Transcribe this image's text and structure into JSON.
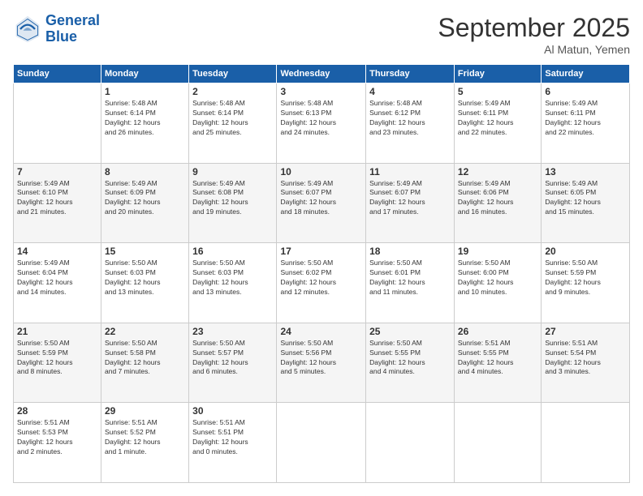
{
  "header": {
    "logo_line1": "General",
    "logo_line2": "Blue",
    "month": "September 2025",
    "location": "Al Matun, Yemen"
  },
  "days_of_week": [
    "Sunday",
    "Monday",
    "Tuesday",
    "Wednesday",
    "Thursday",
    "Friday",
    "Saturday"
  ],
  "weeks": [
    [
      {
        "day": "",
        "info": ""
      },
      {
        "day": "1",
        "info": "Sunrise: 5:48 AM\nSunset: 6:14 PM\nDaylight: 12 hours\nand 26 minutes."
      },
      {
        "day": "2",
        "info": "Sunrise: 5:48 AM\nSunset: 6:14 PM\nDaylight: 12 hours\nand 25 minutes."
      },
      {
        "day": "3",
        "info": "Sunrise: 5:48 AM\nSunset: 6:13 PM\nDaylight: 12 hours\nand 24 minutes."
      },
      {
        "day": "4",
        "info": "Sunrise: 5:48 AM\nSunset: 6:12 PM\nDaylight: 12 hours\nand 23 minutes."
      },
      {
        "day": "5",
        "info": "Sunrise: 5:49 AM\nSunset: 6:11 PM\nDaylight: 12 hours\nand 22 minutes."
      },
      {
        "day": "6",
        "info": "Sunrise: 5:49 AM\nSunset: 6:11 PM\nDaylight: 12 hours\nand 22 minutes."
      }
    ],
    [
      {
        "day": "7",
        "info": "Sunrise: 5:49 AM\nSunset: 6:10 PM\nDaylight: 12 hours\nand 21 minutes."
      },
      {
        "day": "8",
        "info": "Sunrise: 5:49 AM\nSunset: 6:09 PM\nDaylight: 12 hours\nand 20 minutes."
      },
      {
        "day": "9",
        "info": "Sunrise: 5:49 AM\nSunset: 6:08 PM\nDaylight: 12 hours\nand 19 minutes."
      },
      {
        "day": "10",
        "info": "Sunrise: 5:49 AM\nSunset: 6:07 PM\nDaylight: 12 hours\nand 18 minutes."
      },
      {
        "day": "11",
        "info": "Sunrise: 5:49 AM\nSunset: 6:07 PM\nDaylight: 12 hours\nand 17 minutes."
      },
      {
        "day": "12",
        "info": "Sunrise: 5:49 AM\nSunset: 6:06 PM\nDaylight: 12 hours\nand 16 minutes."
      },
      {
        "day": "13",
        "info": "Sunrise: 5:49 AM\nSunset: 6:05 PM\nDaylight: 12 hours\nand 15 minutes."
      }
    ],
    [
      {
        "day": "14",
        "info": "Sunrise: 5:49 AM\nSunset: 6:04 PM\nDaylight: 12 hours\nand 14 minutes."
      },
      {
        "day": "15",
        "info": "Sunrise: 5:50 AM\nSunset: 6:03 PM\nDaylight: 12 hours\nand 13 minutes."
      },
      {
        "day": "16",
        "info": "Sunrise: 5:50 AM\nSunset: 6:03 PM\nDaylight: 12 hours\nand 13 minutes."
      },
      {
        "day": "17",
        "info": "Sunrise: 5:50 AM\nSunset: 6:02 PM\nDaylight: 12 hours\nand 12 minutes."
      },
      {
        "day": "18",
        "info": "Sunrise: 5:50 AM\nSunset: 6:01 PM\nDaylight: 12 hours\nand 11 minutes."
      },
      {
        "day": "19",
        "info": "Sunrise: 5:50 AM\nSunset: 6:00 PM\nDaylight: 12 hours\nand 10 minutes."
      },
      {
        "day": "20",
        "info": "Sunrise: 5:50 AM\nSunset: 5:59 PM\nDaylight: 12 hours\nand 9 minutes."
      }
    ],
    [
      {
        "day": "21",
        "info": "Sunrise: 5:50 AM\nSunset: 5:59 PM\nDaylight: 12 hours\nand 8 minutes."
      },
      {
        "day": "22",
        "info": "Sunrise: 5:50 AM\nSunset: 5:58 PM\nDaylight: 12 hours\nand 7 minutes."
      },
      {
        "day": "23",
        "info": "Sunrise: 5:50 AM\nSunset: 5:57 PM\nDaylight: 12 hours\nand 6 minutes."
      },
      {
        "day": "24",
        "info": "Sunrise: 5:50 AM\nSunset: 5:56 PM\nDaylight: 12 hours\nand 5 minutes."
      },
      {
        "day": "25",
        "info": "Sunrise: 5:50 AM\nSunset: 5:55 PM\nDaylight: 12 hours\nand 4 minutes."
      },
      {
        "day": "26",
        "info": "Sunrise: 5:51 AM\nSunset: 5:55 PM\nDaylight: 12 hours\nand 4 minutes."
      },
      {
        "day": "27",
        "info": "Sunrise: 5:51 AM\nSunset: 5:54 PM\nDaylight: 12 hours\nand 3 minutes."
      }
    ],
    [
      {
        "day": "28",
        "info": "Sunrise: 5:51 AM\nSunset: 5:53 PM\nDaylight: 12 hours\nand 2 minutes."
      },
      {
        "day": "29",
        "info": "Sunrise: 5:51 AM\nSunset: 5:52 PM\nDaylight: 12 hours\nand 1 minute."
      },
      {
        "day": "30",
        "info": "Sunrise: 5:51 AM\nSunset: 5:51 PM\nDaylight: 12 hours\nand 0 minutes."
      },
      {
        "day": "",
        "info": ""
      },
      {
        "day": "",
        "info": ""
      },
      {
        "day": "",
        "info": ""
      },
      {
        "day": "",
        "info": ""
      }
    ]
  ]
}
